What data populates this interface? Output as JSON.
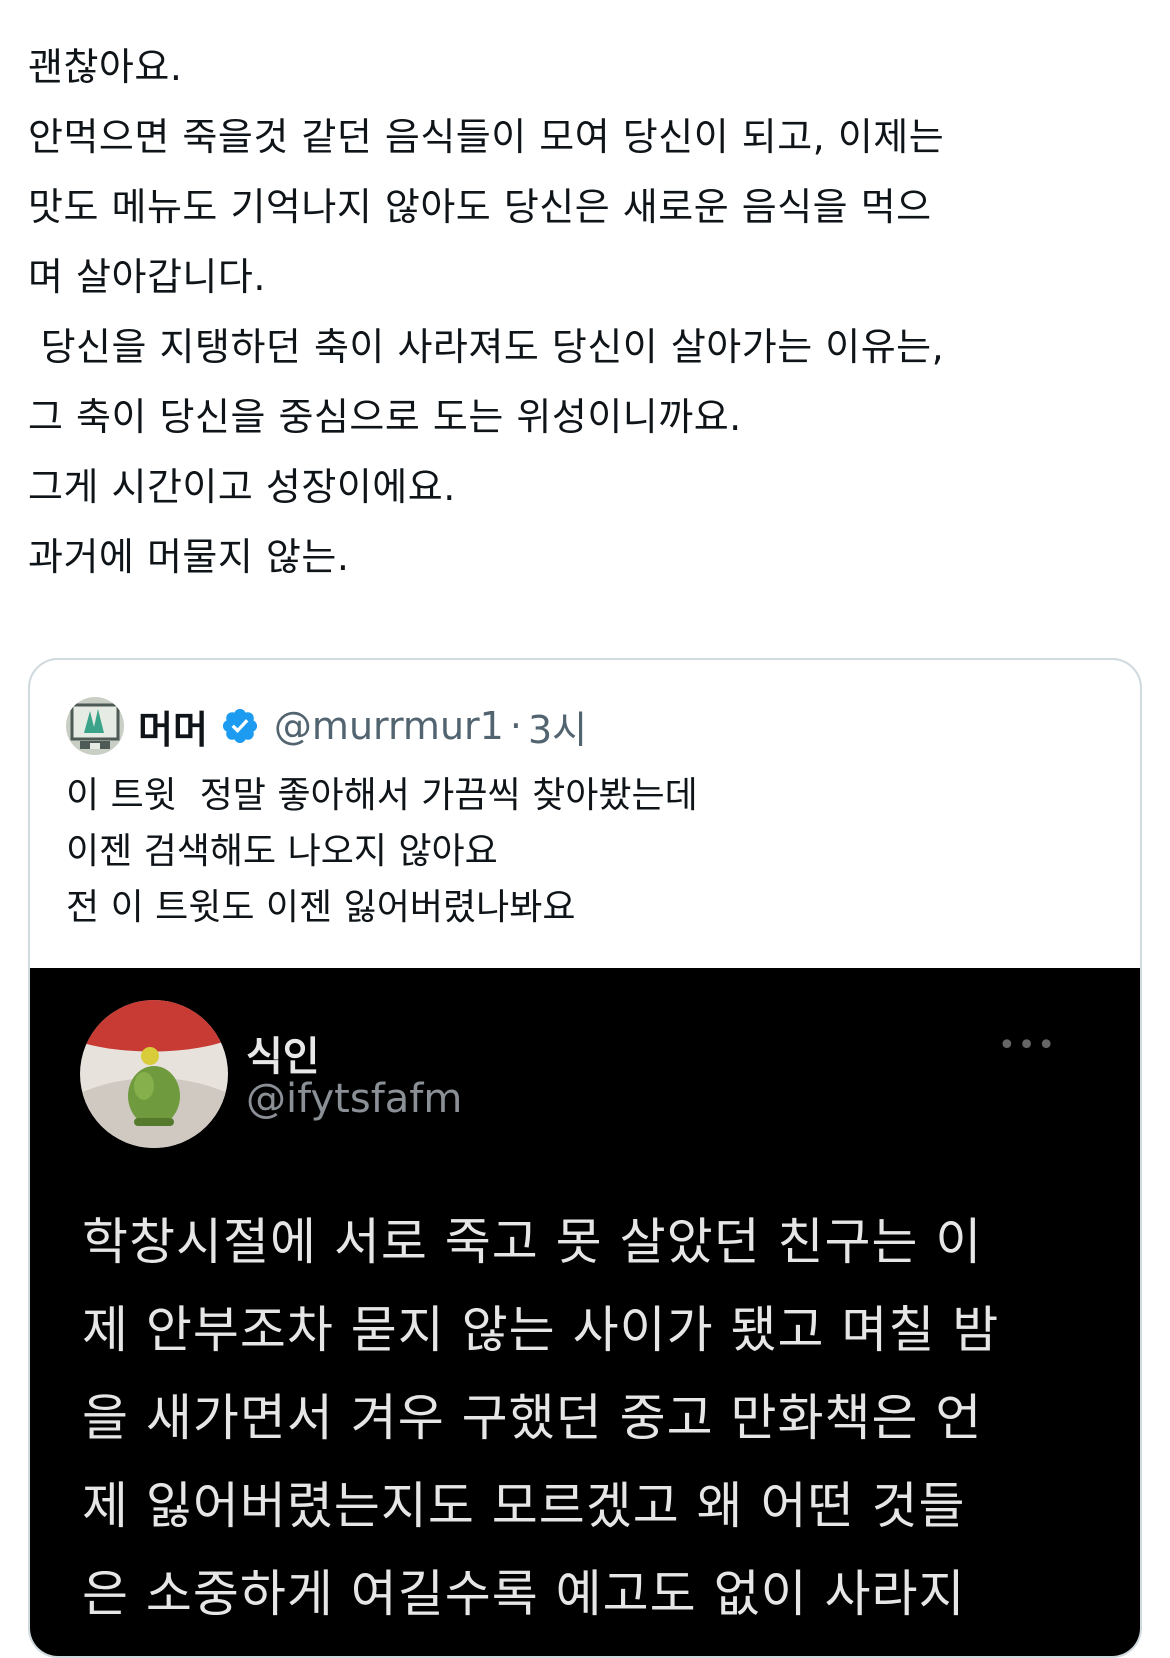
{
  "main_tweet": {
    "lines": [
      "괜찮아요.",
      "안먹으면 죽을것 같던 음식들이 모여 당신이 되고, 이제는",
      "맛도 메뉴도 기억나지 않아도 당신은 새로운 음식을 먹으",
      "며 살아갑니다.",
      " 당신을 지탱하던 축이 사라져도 당신이 살아가는 이유는,",
      "그 축이 당신을 중심으로 도는 위성이니까요.",
      "그게 시간이고 성장이에요.",
      "과거에 머물지 않는."
    ]
  },
  "quote_tweet": {
    "name": "머머",
    "handle": "@murrmur1",
    "separator": "·",
    "time": "3시",
    "icons": [
      "avatar",
      "verified-badge-icon"
    ],
    "lines": [
      "이 트윗  정말 좋아해서 가끔씩 찾아봤는데",
      "이젠 검색해도 나오지 않아요",
      "전 이 트윗도 이젠 잃어버렸나봐요"
    ],
    "media": {
      "name": "식인",
      "handle": "@ifytsfafm",
      "more_icon": "more-horizontal-icon",
      "lines": [
        "학창시절에 서로 죽고 못 살았던 친구는 이",
        "제 안부조차 묻지 않는 사이가 됐고 며칠 밤",
        "을 새가면서 겨우 구했던 중고 만화책은 언",
        "제 잃어버렸는지도 모르겠고 왜 어떤 것들",
        "은 소중하게 여길수록 예고도 없이 사라지"
      ]
    }
  },
  "colors": {
    "text": "#0f1419",
    "secondary": "#536471",
    "border": "#cfd9de",
    "verified": "#1d9bf0",
    "media_bg": "#000000"
  }
}
